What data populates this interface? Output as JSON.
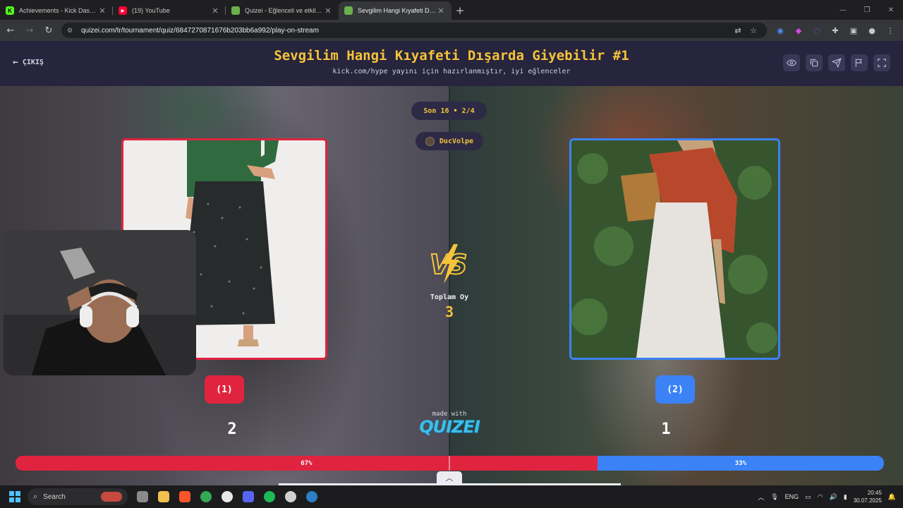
{
  "browser": {
    "tabs": [
      {
        "title": "Achievements - Kick Dashboard",
        "favicon": "kick-icon",
        "color": "#53fc18",
        "active": false
      },
      {
        "title": "(19) YouTube",
        "favicon": "youtube-icon",
        "color": "#ff0033",
        "active": false
      },
      {
        "title": "Quizei - Eğlenceli ve etkileşimli",
        "favicon": "quizei-icon",
        "color": "#6ab04c",
        "active": false
      },
      {
        "title": "Sevgilim Hangi Kıyafeti Dışarda",
        "favicon": "quizei-icon",
        "color": "#6ab04c",
        "active": true
      }
    ],
    "url": "quizei.com/tr/tournament/quiz/6847270871676b203bb6a992/play-on-stream"
  },
  "header": {
    "exit_label": "ÇIKIŞ",
    "title": "Sevgilim Hangi Kıyafeti Dışarda Giyebilir #1",
    "subtitle": "kick.com/hype yayını için hazırlanmıştır, iyi eğlenceler"
  },
  "match": {
    "round_label": "Son 16 • 2/4",
    "user": "DucVolpe",
    "total_label": "Toplam Oy",
    "total_votes": "3",
    "left": {
      "button_label": "(1)",
      "votes": "2",
      "percent_label": "67%",
      "percent": 67
    },
    "right": {
      "button_label": "(2)",
      "votes": "1",
      "percent_label": "33%",
      "percent": 33
    }
  },
  "footer": {
    "made_with": "made with",
    "logo": "QUIZEI"
  },
  "taskbar": {
    "search_label": "Search",
    "lang": "ENG",
    "time": "20:45",
    "date": "30.07.2025"
  },
  "colors": {
    "left_accent": "#e0243f",
    "right_accent": "#3b82f6",
    "title_gold": "#f6c43a",
    "header_bg": "#27253d"
  }
}
